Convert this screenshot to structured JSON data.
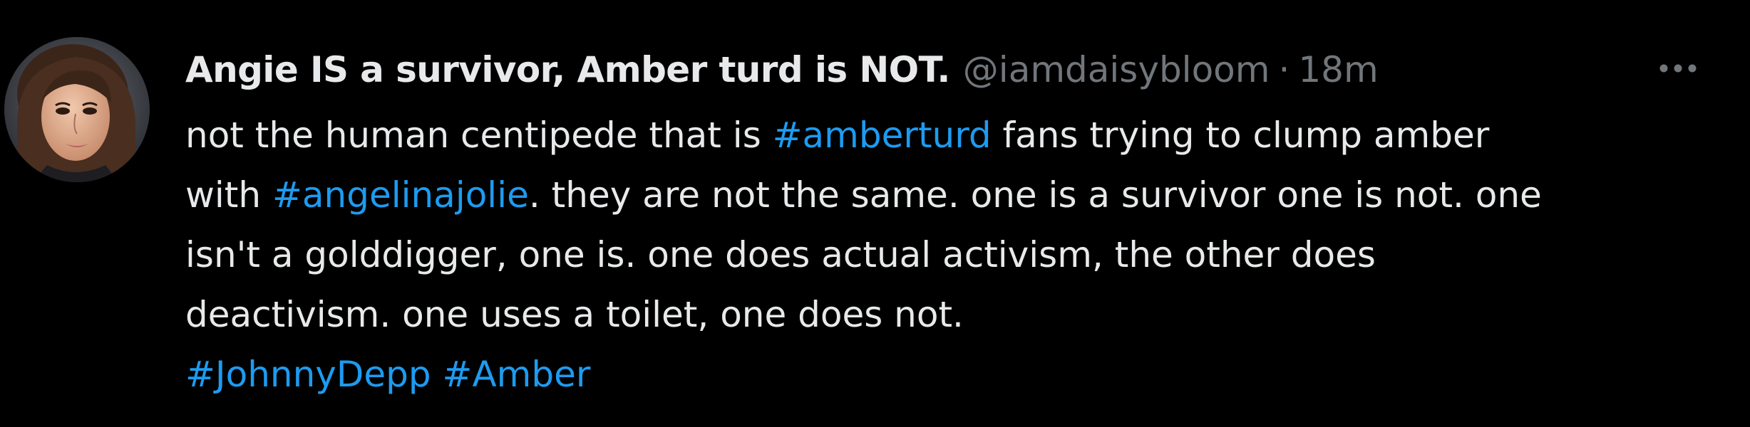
{
  "tweet": {
    "display_name": "Angie IS a survivor, Amber turd is NOT.",
    "handle": "@iamdaisybloom",
    "separator": "·",
    "time": "18m",
    "lines": [
      [
        {
          "text": "not the human centipede that is ",
          "type": "text"
        },
        {
          "text": "#amberturd",
          "type": "hashtag"
        },
        {
          "text": " fans trying to clump amber",
          "type": "text"
        }
      ],
      [
        {
          "text": "with ",
          "type": "text"
        },
        {
          "text": "#angelinajolie",
          "type": "hashtag"
        },
        {
          "text": ". they are not the same. one is a survivor one is not. one",
          "type": "text"
        }
      ],
      [
        {
          "text": "isn't a golddigger, one is. one does actual activism, the other does",
          "type": "text"
        }
      ],
      [
        {
          "text": "deactivism. one uses a toilet, one does not.",
          "type": "text"
        }
      ],
      [
        {
          "text": "#JohnnyDepp",
          "type": "hashtag"
        },
        {
          "text": " ",
          "type": "text"
        },
        {
          "text": "#Amber",
          "type": "hashtag"
        }
      ]
    ]
  },
  "icons": {
    "avatar": "profile-photo",
    "more": "more-horizontal-icon"
  },
  "colors": {
    "background": "#000000",
    "text": "#e7e9ea",
    "muted": "#71767b",
    "accent": "#1d9bf0"
  }
}
